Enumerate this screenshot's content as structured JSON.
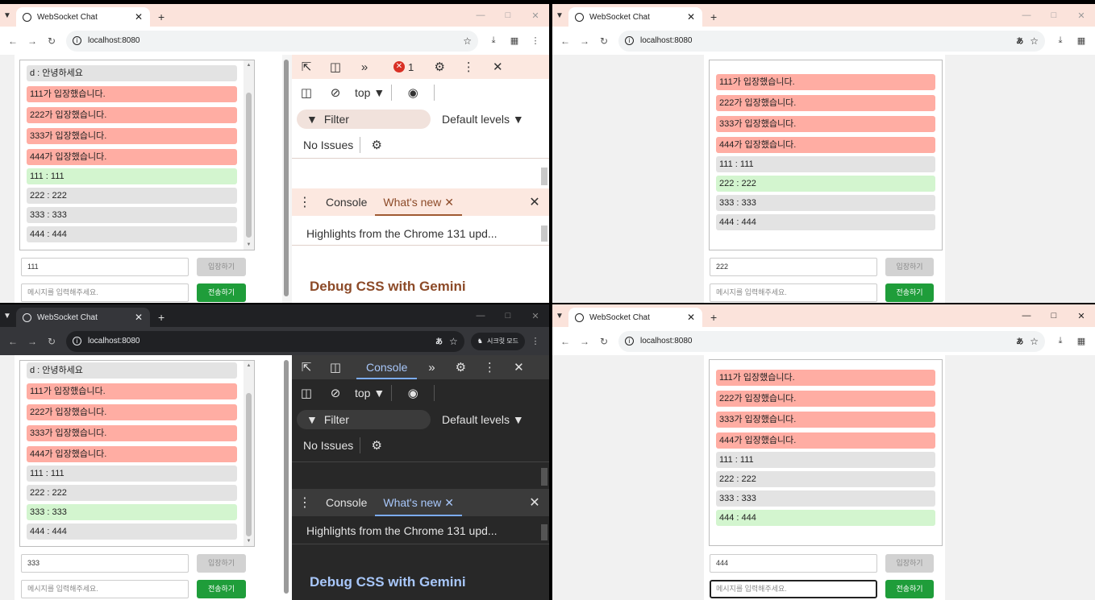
{
  "common": {
    "tab_title": "WebSocket Chat",
    "url": "localhost:8080",
    "join_button": "입장하기",
    "send_button": "전송하기",
    "message_placeholder": "메시지를 입력해주세요.",
    "incognito_label": "시크릿 모드"
  },
  "devtools": {
    "error_count": "1",
    "console_tab": "Console",
    "whats_new_tab": "What's new",
    "context": "top",
    "filter_placeholder": "Filter",
    "levels": "Default levels",
    "issues": "No Issues",
    "highlights": "Highlights from the Chrome 131 upd...",
    "gemini_heading": "Debug CSS with Gemini"
  },
  "windows": {
    "tl": {
      "username": "111",
      "messages": [
        "d : 안녕하세요",
        "111가 입장했습니다.",
        "222가 입장했습니다.",
        "333가 입장했습니다.",
        "444가 입장했습니다.",
        "111 : 111",
        "222 : 222",
        "333 : 333",
        "444 : 444"
      ]
    },
    "tr": {
      "username": "222",
      "messages": [
        "111가 입장했습니다.",
        "222가 입장했습니다.",
        "333가 입장했습니다.",
        "444가 입장했습니다.",
        "111 : 111",
        "222 : 222",
        "333 : 333",
        "444 : 444"
      ]
    },
    "bl": {
      "username": "333",
      "messages": [
        "d : 안녕하세요",
        "111가 입장했습니다.",
        "222가 입장했습니다.",
        "333가 입장했습니다.",
        "444가 입장했습니다.",
        "111 : 111",
        "222 : 222",
        "333 : 333",
        "444 : 444"
      ]
    },
    "br": {
      "username": "444",
      "messages": [
        "111가 입장했습니다.",
        "222가 입장했습니다.",
        "333가 입장했습니다.",
        "444가 입장했습니다.",
        "111 : 111",
        "222 : 222",
        "333 : 333",
        "444 : 444"
      ]
    }
  },
  "colors": {
    "join_message": "#ffada3",
    "own_message": "#d3f5cf",
    "other_message": "#e3e3e3",
    "send_button": "#1f9d3a"
  }
}
